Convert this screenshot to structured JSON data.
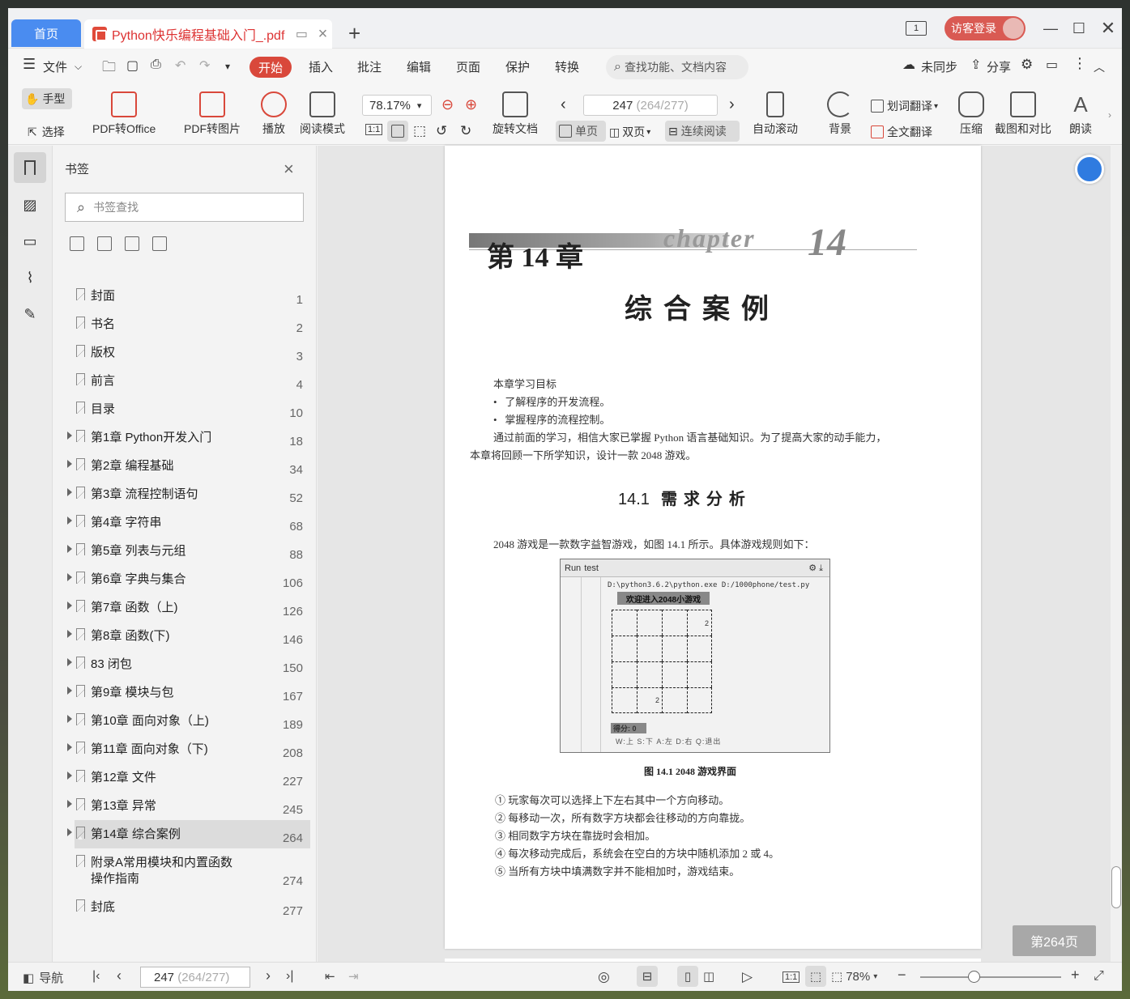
{
  "titlebar": {
    "home_tab": "首页",
    "doc_tab": "Python快乐编程基础入门_.pdf",
    "login": "访客登录",
    "window_counter": "1"
  },
  "menu": {
    "file": "文件",
    "items": [
      "开始",
      "插入",
      "批注",
      "编辑",
      "页面",
      "保护",
      "转换"
    ],
    "search": "查找功能、文档内容",
    "sync": "未同步",
    "share": "分享"
  },
  "ribbon": {
    "hand": "手型",
    "select": "选择",
    "pdf_office": "PDF转Office",
    "pdf_image": "PDF转图片",
    "play": "播放",
    "read_mode": "阅读模式",
    "zoom": "78.17%",
    "rotate": "旋转文档",
    "page_current": "247",
    "page_total": "(264/277)",
    "single": "单页",
    "double": "双页",
    "continuous": "连续阅读",
    "autoscroll": "自动滚动",
    "background": "背景",
    "word_translate": "划词翻译",
    "full_translate": "全文翻译",
    "compress": "压缩",
    "screenshot": "截图和对比",
    "read_aloud": "朗读"
  },
  "bookmarks": {
    "title": "书签",
    "search_placeholder": "书签查找",
    "items": [
      {
        "label": "封面",
        "page": "1",
        "expandable": false
      },
      {
        "label": "书名",
        "page": "2",
        "expandable": false
      },
      {
        "label": "版权",
        "page": "3",
        "expandable": false
      },
      {
        "label": "前言",
        "page": "4",
        "expandable": false
      },
      {
        "label": "目录",
        "page": "10",
        "expandable": false
      },
      {
        "label": "第1章 Python开发入门",
        "page": "18",
        "expandable": true
      },
      {
        "label": "第2章 编程基础",
        "page": "34",
        "expandable": true
      },
      {
        "label": "第3章 流程控制语句",
        "page": "52",
        "expandable": true
      },
      {
        "label": "第4章 字符串",
        "page": "68",
        "expandable": true
      },
      {
        "label": "第5章 列表与元组",
        "page": "88",
        "expandable": true
      },
      {
        "label": "第6章 字典与集合",
        "page": "106",
        "expandable": true
      },
      {
        "label": "第7章 函数（上)",
        "page": "126",
        "expandable": true
      },
      {
        "label": "第8章 函数(下)",
        "page": "146",
        "expandable": true
      },
      {
        "label": "83 闭包",
        "page": "150",
        "expandable": true
      },
      {
        "label": "第9章 模块与包",
        "page": "167",
        "expandable": true
      },
      {
        "label": "第10章 面向对象（上)",
        "page": "189",
        "expandable": true
      },
      {
        "label": "第11章 面向对象（下)",
        "page": "208",
        "expandable": true
      },
      {
        "label": "第12章 文件",
        "page": "227",
        "expandable": true
      },
      {
        "label": "第13章 异常",
        "page": "245",
        "expandable": true
      },
      {
        "label": "第14章 综合案例",
        "page": "264",
        "expandable": true,
        "selected": true
      },
      {
        "label": "附录A常用模块和内置函数",
        "label2": "操作指南",
        "page": "274",
        "expandable": false
      },
      {
        "label": "封底",
        "page": "277",
        "expandable": false
      }
    ]
  },
  "pdf": {
    "chapter_label": "第 14 章",
    "chapter_word": "chapter",
    "chapter_num": "14",
    "chapter_title": "综合案例",
    "goals_title": "本章学习目标",
    "goals": [
      "了解程序的开发流程。",
      "掌握程序的流程控制。"
    ],
    "intro_line1": "通过前面的学习，相信大家已掌握 Python 语言基础知识。为了提高大家的动手能力，",
    "intro_line2": "本章将回顾一下所学知识，设计一款 2048 游戏。",
    "section_num": "14.1",
    "section_title": "需求分析",
    "section_intro": "2048 游戏是一款数字益智游戏，如图 14.1 所示。具体游戏规则如下：",
    "shot_run": "Run",
    "shot_tab": "test",
    "shot_path": "D:\\python3.6.2\\python.exe D:/1000phone/test.py",
    "shot_welcome": "欢迎进入2048小游戏",
    "shot_cell_a": "2",
    "shot_cell_b": "2",
    "shot_score": "得分: 0",
    "shot_keys": "W:上 S:下 A:左 D:右 Q:退出",
    "figure_caption": "图 14.1   2048 游戏界面",
    "rules": [
      "① 玩家每次可以选择上下左右其中一个方向移动。",
      "② 每移动一次，所有数字方块都会往移动的方向靠拢。",
      "③ 相同数字方块在靠拢时会相加。",
      "④ 每次移动完成后，系统会在空白的方块中随机添加 2 或 4。",
      "⑤ 当所有方块中填满数字并不能相加时，游戏结束。"
    ]
  },
  "page_tag": "第264页",
  "statusbar": {
    "nav": "导航",
    "page_current": "247",
    "page_total": "(264/277)",
    "zoom": "78%"
  },
  "colors": {
    "accent": "#d9483b",
    "home_tab": "#4a8cf0"
  }
}
